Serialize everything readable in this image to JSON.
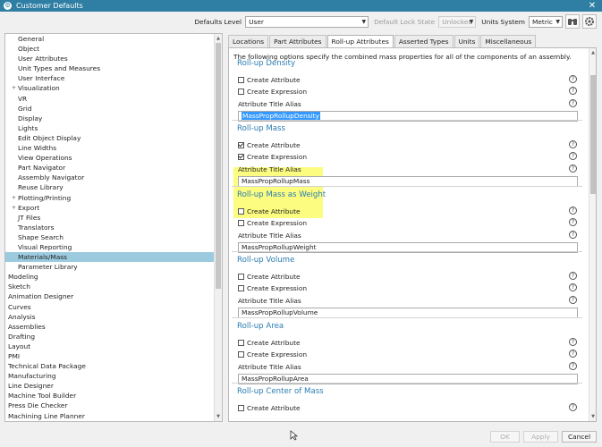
{
  "window": {
    "title": "Customer Defaults",
    "close_label": "✕"
  },
  "toolbar": {
    "defaults_level_label": "Defaults Level",
    "defaults_level_value": "User",
    "lock_state_label": "Default Lock State",
    "lock_state_value": "Unlocked",
    "units_system_label": "Units System",
    "units_system_value": "Metric"
  },
  "tree": {
    "items": [
      {
        "label": "General",
        "level": "sub"
      },
      {
        "label": "Object",
        "level": "sub"
      },
      {
        "label": "User Attributes",
        "level": "sub"
      },
      {
        "label": "Unit Types and Measures",
        "level": "sub"
      },
      {
        "label": "User Interface",
        "level": "sub"
      },
      {
        "label": "Visualization",
        "level": "sub",
        "expander": "+"
      },
      {
        "label": "VR",
        "level": "sub"
      },
      {
        "label": "Grid",
        "level": "sub"
      },
      {
        "label": "Display",
        "level": "sub"
      },
      {
        "label": "Lights",
        "level": "sub"
      },
      {
        "label": "Edit Object Display",
        "level": "sub"
      },
      {
        "label": "Line Widths",
        "level": "sub"
      },
      {
        "label": "View Operations",
        "level": "sub"
      },
      {
        "label": "Part Navigator",
        "level": "sub"
      },
      {
        "label": "Assembly Navigator",
        "level": "sub"
      },
      {
        "label": "Reuse Library",
        "level": "sub"
      },
      {
        "label": "Plotting/Printing",
        "level": "sub",
        "expander": "+"
      },
      {
        "label": "Export",
        "level": "sub",
        "expander": "+"
      },
      {
        "label": "JT Files",
        "level": "sub"
      },
      {
        "label": "Translators",
        "level": "sub"
      },
      {
        "label": "Shape Search",
        "level": "sub"
      },
      {
        "label": "Visual Reporting",
        "level": "sub"
      },
      {
        "label": "Materials/Mass",
        "level": "sub",
        "selected": true
      },
      {
        "label": "Parameter Library",
        "level": "sub"
      },
      {
        "label": "Modeling",
        "level": "top"
      },
      {
        "label": "Sketch",
        "level": "top"
      },
      {
        "label": "Animation Designer",
        "level": "top"
      },
      {
        "label": "Curves",
        "level": "top"
      },
      {
        "label": "Analysis",
        "level": "top"
      },
      {
        "label": "Assemblies",
        "level": "top"
      },
      {
        "label": "Drafting",
        "level": "top"
      },
      {
        "label": "Layout",
        "level": "top"
      },
      {
        "label": "PMI",
        "level": "top"
      },
      {
        "label": "Technical Data Package",
        "level": "top"
      },
      {
        "label": "Manufacturing",
        "level": "top"
      },
      {
        "label": "Line Designer",
        "level": "top"
      },
      {
        "label": "Machine Tool Builder",
        "level": "top"
      },
      {
        "label": "Press Die Checker",
        "level": "top"
      },
      {
        "label": "Machining Line Planner",
        "level": "top"
      }
    ],
    "scroll_up": "▲",
    "scroll_down": "▼"
  },
  "tabs": [
    {
      "label": "Locations"
    },
    {
      "label": "Part Attributes"
    },
    {
      "label": "Roll-up Attributes",
      "active": true
    },
    {
      "label": "Asserted Types"
    },
    {
      "label": "Units"
    },
    {
      "label": "Miscellaneous"
    }
  ],
  "panel": {
    "description": "The following options specify the combined mass properties for all of the components of an assembly.",
    "help_glyph": "?",
    "sections": [
      {
        "heading": "Roll-up Density",
        "create_attribute": "Create Attribute",
        "attribute_checked": false,
        "create_expression": "Create Expression",
        "expression_checked": false,
        "alias_label": "Attribute Title Alias",
        "alias_value": "MassPropRollupDensity",
        "alias_selected": true
      },
      {
        "heading": "Roll-up Mass",
        "create_attribute": "Create Attribute",
        "attribute_checked": true,
        "create_expression": "Create Expression",
        "expression_checked": true,
        "alias_label": "Attribute Title Alias",
        "alias_value": "MassPropRollupMass",
        "alias_selected": false
      },
      {
        "heading": "Roll-up Mass as Weight",
        "create_attribute": "Create Attribute",
        "attribute_checked": false,
        "create_expression": "Create Expression",
        "expression_checked": false,
        "alias_label": "Attribute Title Alias",
        "alias_value": "MassPropRollupWeight",
        "alias_selected": false
      },
      {
        "heading": "Roll-up Volume",
        "create_attribute": "Create Attribute",
        "attribute_checked": false,
        "create_expression": "Create Expression",
        "expression_checked": false,
        "alias_label": "Attribute Title Alias",
        "alias_value": "MassPropRollupVolume",
        "alias_selected": false
      },
      {
        "heading": "Roll-up Area",
        "create_attribute": "Create Attribute",
        "attribute_checked": false,
        "create_expression": "Create Expression",
        "expression_checked": false,
        "alias_label": "Attribute Title Alias",
        "alias_value": "MassPropRollupArea",
        "alias_selected": false
      },
      {
        "heading": "Roll-up Center of Mass",
        "create_attribute": "Create Attribute",
        "attribute_checked": false,
        "create_expression": "",
        "expression_checked": false,
        "alias_label": "",
        "alias_value": "",
        "alias_selected": false
      }
    ]
  },
  "buttons": {
    "ok": "OK",
    "apply": "Apply",
    "cancel": "Cancel"
  },
  "colors": {
    "titlebar": "#2e7fa3",
    "selection": "#9ccbe0",
    "heading": "#2b7db0",
    "highlight": "#fbfb6b"
  }
}
